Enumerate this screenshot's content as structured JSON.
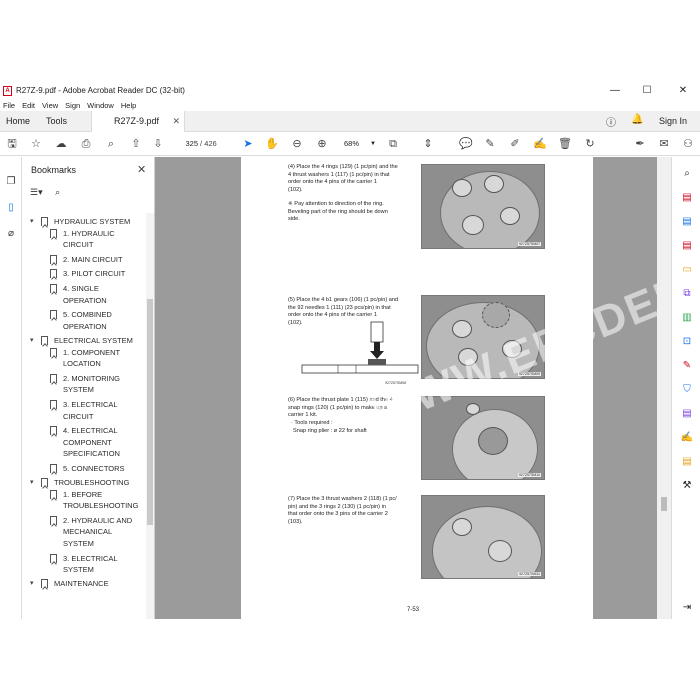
{
  "window": {
    "title": "R27Z-9.pdf - Adobe Acrobat Reader DC (32-bit)",
    "minimize": "—",
    "maximize": "☐",
    "close": "✕"
  },
  "menubar": [
    "File",
    "Edit",
    "View",
    "Sign",
    "Window",
    "Help"
  ],
  "tabs": {
    "home": "Home",
    "tools": "Tools",
    "document": "R27Z-9.pdf",
    "sign_in": "Sign In"
  },
  "toolbar": {
    "current_page": "325",
    "page_separator": "/",
    "total_pages": "426",
    "zoom": "68%"
  },
  "bookmarks": {
    "title": "Bookmarks",
    "items": [
      {
        "label": "HYDRAULIC SYSTEM",
        "level": 0
      },
      {
        "label": "1. HYDRAULIC",
        "level": 1
      },
      {
        "label": "CIRCUIT",
        "level": 2
      },
      {
        "label": "2. MAIN CIRCUIT",
        "level": 1
      },
      {
        "label": "3. PILOT CIRCUIT",
        "level": 1
      },
      {
        "label": "4. SINGLE",
        "level": 1
      },
      {
        "label": "OPERATION",
        "level": 2
      },
      {
        "label": "5. COMBINED",
        "level": 1
      },
      {
        "label": "OPERATION",
        "level": 2
      },
      {
        "label": "ELECTRICAL SYSTEM",
        "level": 0
      },
      {
        "label": "1. COMPONENT",
        "level": 1
      },
      {
        "label": "LOCATION",
        "level": 2
      },
      {
        "label": "2. MONITORING",
        "level": 1
      },
      {
        "label": "SYSTEM",
        "level": 2
      },
      {
        "label": "3. ELECTRICAL",
        "level": 1
      },
      {
        "label": "CIRCUIT",
        "level": 2
      },
      {
        "label": "4. ELECTRICAL",
        "level": 1
      },
      {
        "label": "COMPONENT",
        "level": 2
      },
      {
        "label": "SPECIFICATION",
        "level": 2
      },
      {
        "label": "5. CONNECTORS",
        "level": 1
      },
      {
        "label": "TROUBLESHOOTING",
        "level": 0
      },
      {
        "label": "1. BEFORE",
        "level": 1
      },
      {
        "label": "TROUBLESHOOTING",
        "level": 2
      },
      {
        "label": "2. HYDRAULIC AND",
        "level": 1
      },
      {
        "label": "MECHANICAL",
        "level": 2
      },
      {
        "label": "SYSTEM",
        "level": 2
      },
      {
        "label": "3. ELECTRICAL",
        "level": 1
      },
      {
        "label": "SYSTEM",
        "level": 2
      },
      {
        "label": "MAINTENANCE",
        "level": 0
      }
    ]
  },
  "document": {
    "steps": [
      {
        "lines": [
          "(4) Place the 4 rings (129) (1 pc/pin) and the",
          "4 thrust washers 1 (117) (1 pc/pin) in that",
          "order onto the 4 pins of the carrier 1",
          "(102)."
        ]
      },
      {
        "lines": [
          "(5) Place the 4 b1 gears (106) (1 pc/pin) and",
          "the 92 needles 1 (111) (23 pcs/pin) in that",
          "order onto the 4 pins of the carrier 1",
          "(102)."
        ]
      },
      {
        "lines": [
          "(6) Place the thrust plate 1 (115) and the 4",
          "snap rings (120) (1 pc/pin) to make up a",
          "carrier 1 kit.",
          "· Tools required :",
          "Snap ring plier : ø 22 for shaft"
        ]
      },
      {
        "lines": [
          "(7) Place the 3 thrust washers 2 (118) (1 pc/",
          "pin) and the 3 rings 2 (130) (1 pc/pin) in",
          "that order onto the 3 pins of the carrier 2",
          "(103)."
        ]
      }
    ],
    "note": [
      "※ Pay attention to direction of the ring.",
      "Beveling part of the ring should be down",
      "side."
    ],
    "figure_codes": [
      "927Z57SM07",
      "927Z57SM08",
      "927Z57SM09",
      "927Z57SM10",
      "927Z57SM11"
    ],
    "page_number": "7-53",
    "watermark": "WWW.EPCDEPO.COM"
  },
  "colors": {
    "accent": "#1473e6",
    "doc_background": "#9b9b9b",
    "pdf_icon": "#d0021b"
  }
}
